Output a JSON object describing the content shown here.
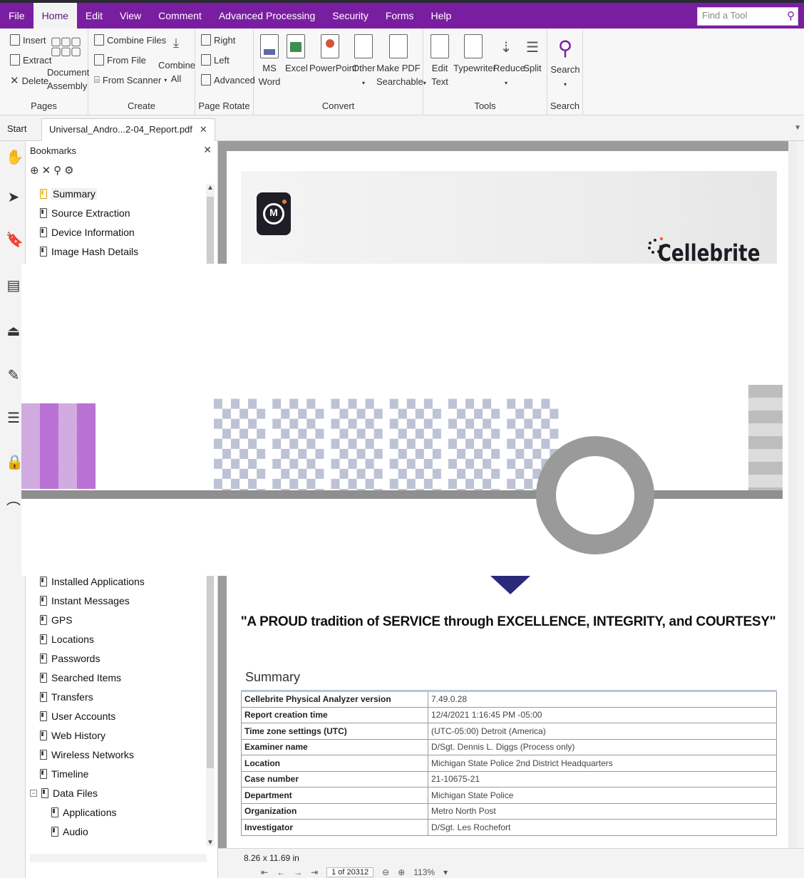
{
  "menubar": {
    "items": [
      "File",
      "Home",
      "Edit",
      "View",
      "Comment",
      "Advanced Processing",
      "Security",
      "Forms",
      "Help"
    ],
    "active": "Home",
    "find_placeholder": "Find a Tool"
  },
  "ribbon": {
    "pages": {
      "label": "Pages",
      "insert": "Insert",
      "extract": "Extract",
      "delete": "Delete",
      "document_assembly_1": "Document",
      "document_assembly_2": "Assembly"
    },
    "create": {
      "label": "Create",
      "combine_files": "Combine Files",
      "from_file": "From File",
      "from_scanner": "From Scanner",
      "combine_all_1": "Combine",
      "combine_all_2": "All"
    },
    "page_rotate": {
      "label": "Page Rotate",
      "right": "Right",
      "left": "Left",
      "advanced": "Advanced"
    },
    "convert": {
      "label": "Convert",
      "ms_word_1": "MS",
      "ms_word_2": "Word",
      "excel": "Excel",
      "powerpoint": "PowerPoint",
      "other": "Other",
      "make_pdf_1": "Make PDF",
      "make_pdf_2": "Searchable"
    },
    "tools": {
      "label": "Tools",
      "edit_text_1": "Edit",
      "edit_text_2": "Text",
      "typewriter": "Typewriter",
      "reduce": "Reduce",
      "split": "Split"
    },
    "search": {
      "label": "Search",
      "search": "Search"
    }
  },
  "tabs": {
    "start": "Start",
    "document": "Universal_Andro...2-04_Report.pdf"
  },
  "bookmarks": {
    "title": "Bookmarks",
    "items": [
      {
        "label": "Summary",
        "selected": true
      },
      {
        "label": "Source Extraction"
      },
      {
        "label": "Device Information"
      },
      {
        "label": "Image Hash Details"
      }
    ],
    "items_lower": [
      {
        "label": "Installed Applications"
      },
      {
        "label": "Instant Messages"
      },
      {
        "label": "GPS"
      },
      {
        "label": "Locations"
      },
      {
        "label": "Passwords"
      },
      {
        "label": "Searched Items"
      },
      {
        "label": "Transfers"
      },
      {
        "label": "User Accounts"
      },
      {
        "label": "Web History"
      },
      {
        "label": "Wireless Networks"
      },
      {
        "label": "Timeline"
      },
      {
        "label": "Data Files"
      },
      {
        "label": "Applications"
      },
      {
        "label": "Audio"
      }
    ]
  },
  "document": {
    "brand": "Cellebrite",
    "motto": "\"A PROUD tradition of SERVICE through EXCELLENCE, INTEGRITY, and COURTESY\"",
    "summary_title": "Summary",
    "summary_rows": [
      [
        "Cellebrite Physical Analyzer version",
        "7.49.0.28"
      ],
      [
        "Report creation time",
        "12/4/2021 1:16:45 PM -05:00"
      ],
      [
        "Time zone settings (UTC)",
        "(UTC-05:00) Detroit (America)"
      ],
      [
        "Examiner name",
        "D/Sgt. Dennis L. Diggs (Process only)"
      ],
      [
        "Location",
        "Michigan State Police 2nd District Headquarters"
      ],
      [
        "Case number",
        "21-10675-21"
      ],
      [
        "Department",
        "Michigan State Police"
      ],
      [
        "Organization",
        "Metro North Post"
      ],
      [
        "Investigator",
        "D/Sgt. Les Rochefort"
      ]
    ]
  },
  "statusbar": {
    "page_size": "8.26 x 11.69 in",
    "page_indicator": "1 of 20312",
    "zoom": "113%"
  },
  "colors": {
    "brand_purple": "#7a1ea1",
    "page_bg": "#9b9b9b"
  }
}
